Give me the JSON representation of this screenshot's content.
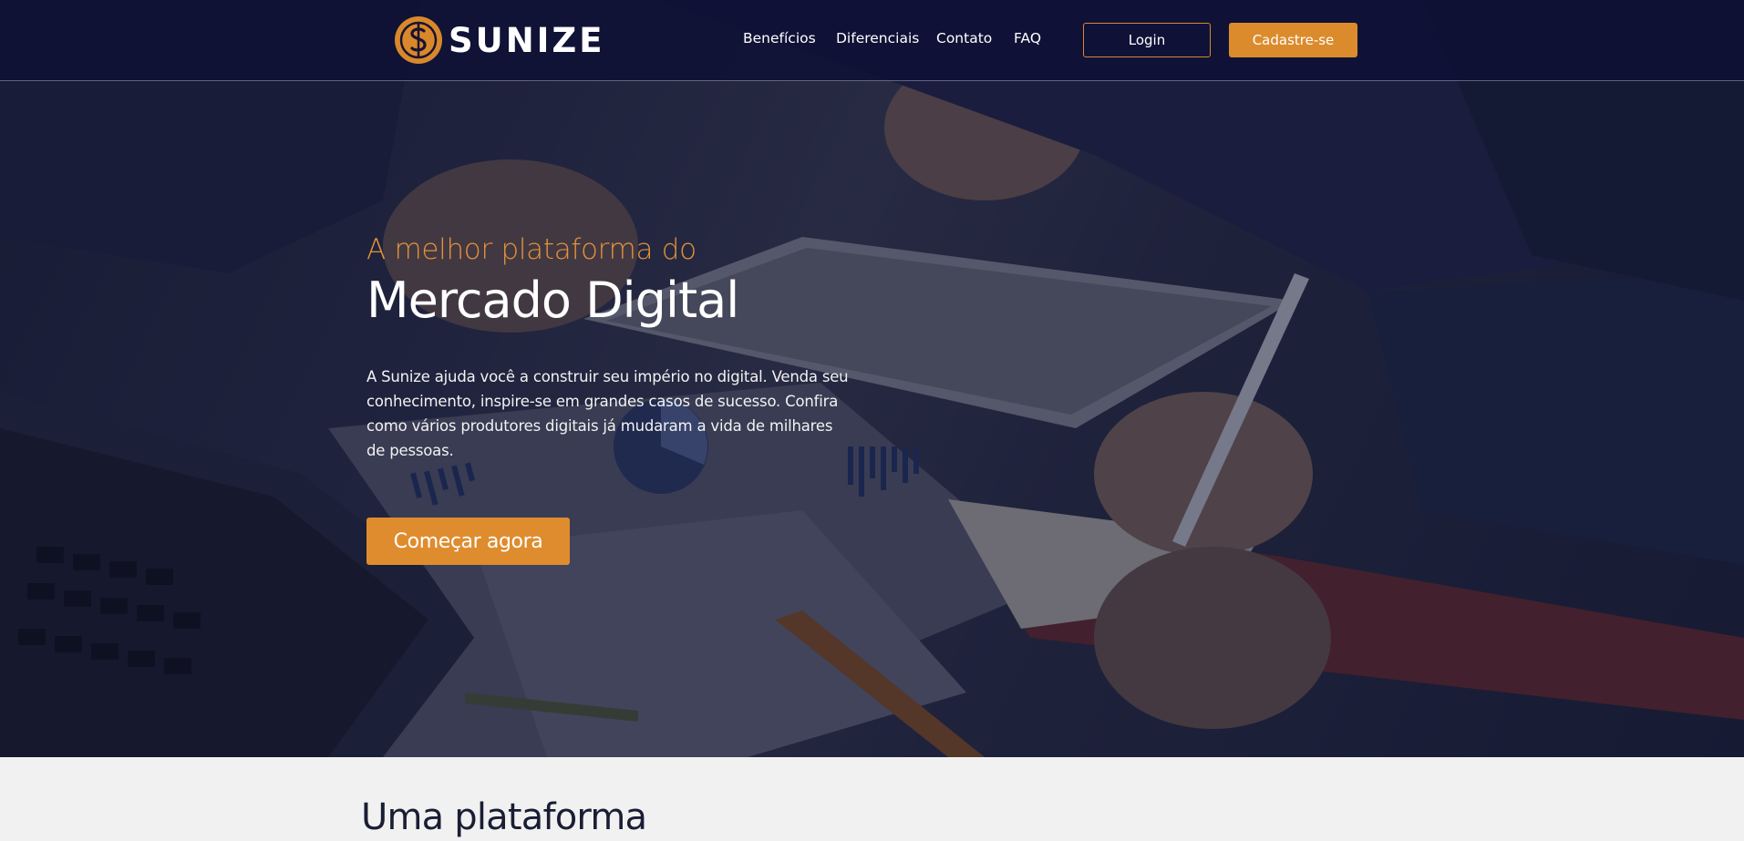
{
  "brand": {
    "name": "SUNIZE",
    "accent_color": "#dc8b2c",
    "logo_icon": "sunize-dollar-logo-icon"
  },
  "nav": {
    "links": [
      "Benefícios",
      "Diferenciais",
      "Contato",
      "FAQ"
    ],
    "login_label": "Login",
    "signup_label": "Cadastre-se"
  },
  "hero": {
    "kicker": "A melhor plataforma do",
    "title": "Mercado Digital",
    "description": "A Sunize ajuda você a construir seu império no digital. Venda seu conhecimento, inspire-se em grandes casos de sucesso. Confira como vários produtores digitais já mudaram a vida de milhares de pessoas.",
    "cta_label": "Começar agora"
  },
  "section": {
    "title": "Uma plataforma"
  }
}
